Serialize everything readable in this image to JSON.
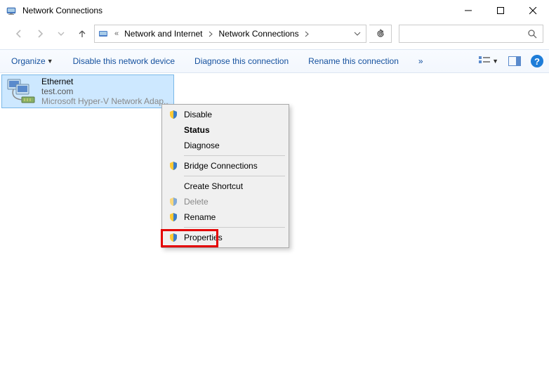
{
  "window": {
    "title": "Network Connections"
  },
  "breadcrumb": {
    "parent": "Network and Internet",
    "current": "Network Connections"
  },
  "toolbar": {
    "organize": "Organize",
    "disable": "Disable this network device",
    "diagnose": "Diagnose this connection",
    "rename": "Rename this connection",
    "more": "»"
  },
  "adapter": {
    "name": "Ethernet",
    "domain": "test.com",
    "description": "Microsoft Hyper-V Network Adap..."
  },
  "context_menu": {
    "disable": "Disable",
    "status": "Status",
    "diagnose": "Diagnose",
    "bridge": "Bridge Connections",
    "shortcut": "Create Shortcut",
    "delete": "Delete",
    "rename": "Rename",
    "properties": "Properties"
  }
}
